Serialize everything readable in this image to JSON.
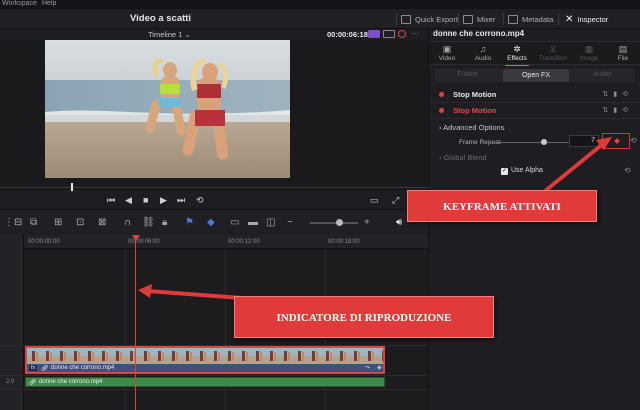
{
  "menubar": {
    "workspace": "Workspace",
    "help": "Help"
  },
  "header": {
    "project_title": "Video a scatti",
    "tools": [
      {
        "label": "Quick Export",
        "icon": "export-icon"
      },
      {
        "label": "Mixer",
        "icon": "mixer-icon"
      },
      {
        "label": "Metadata",
        "icon": "metadata-icon"
      },
      {
        "label": "Inspector",
        "icon": "inspector-icon",
        "active": true
      }
    ]
  },
  "viewer": {
    "timeline_select": "Timeline 1",
    "timecode": "00:00:06:18"
  },
  "timeline": {
    "ruler_labels": [
      "00:00:00:00",
      "00:00:06:00",
      "00:00:12:00",
      "00:00:18:00"
    ],
    "video_track_number": "2.0",
    "video_clip_name": "donne che corrono.mp4",
    "audio_clip_name": "donne che corrono.mp4"
  },
  "inspector": {
    "clip_name": "donne che corrono.mp4",
    "tabs": [
      {
        "label": "Video",
        "icon": "video-icon"
      },
      {
        "label": "Audio",
        "icon": "audio-icon"
      },
      {
        "label": "Effects",
        "icon": "effects-icon",
        "active": true
      },
      {
        "label": "Transition",
        "icon": "transition-icon",
        "disabled": true
      },
      {
        "label": "Image",
        "icon": "image-icon",
        "disabled": true
      },
      {
        "label": "File",
        "icon": "file-icon"
      }
    ],
    "subtabs": [
      "Fusion",
      "Open FX",
      "Audio"
    ],
    "effects": [
      {
        "label": "Stop Motion",
        "highlighted": false
      },
      {
        "label": "Stop Motion",
        "highlighted": true
      }
    ],
    "advanced_options": "Advanced Options",
    "frame_repeat_label": "Frame Repeat",
    "frame_repeat_value": "7",
    "frame_repeat_fraction": 0.55,
    "global_blend": "Global Blend",
    "use_alpha": "Use Alpha",
    "use_alpha_checked": true
  },
  "annotations": {
    "keyframe": "KEYFRAME ATTIVATI",
    "playhead": "INDICATORE DI RIPRODUZIONE"
  },
  "colors": {
    "accent_red": "#e03a3a",
    "clip_blue": "#40577a",
    "clip_green": "#3f8a4a",
    "playhead": "#e0403a"
  }
}
